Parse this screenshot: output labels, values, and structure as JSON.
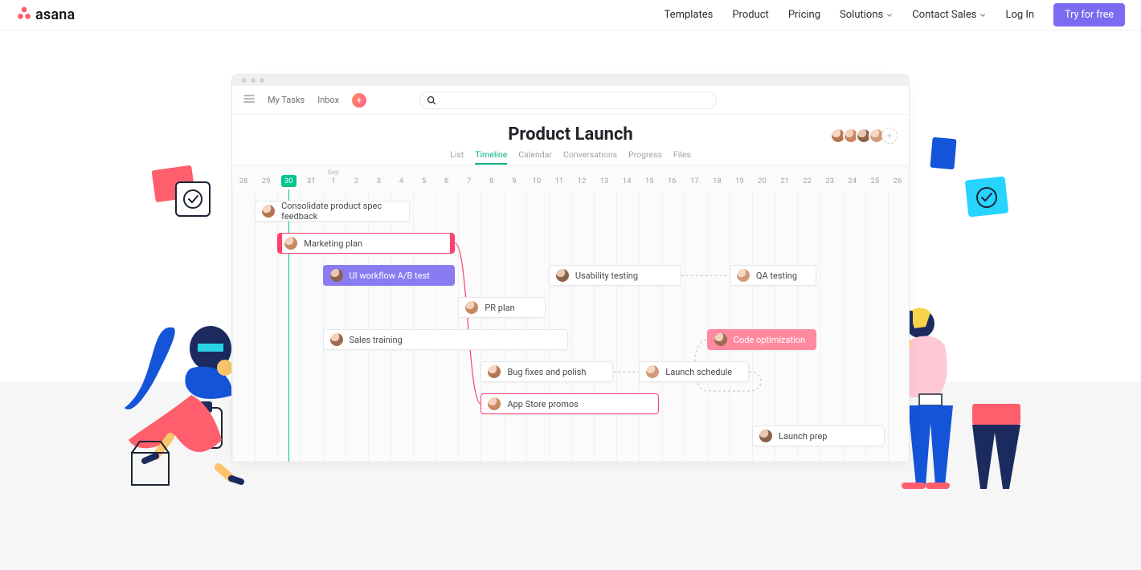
{
  "nav": {
    "brand": "asana",
    "links": [
      "Templates",
      "Product",
      "Pricing",
      "Solutions",
      "Contact Sales",
      "Log In"
    ],
    "cta": "Try for free"
  },
  "app": {
    "toolbar": {
      "my_tasks": "My Tasks",
      "inbox": "Inbox"
    },
    "project": {
      "title": "Product Launch",
      "tabs": [
        "List",
        "Timeline",
        "Calendar",
        "Conversations",
        "Progress",
        "Files"
      ],
      "active_tab": 1
    },
    "timeline": {
      "month_label": "Sep",
      "month_label_day_index": 4,
      "days": [
        "28",
        "29",
        "30",
        "31",
        "1",
        "2",
        "3",
        "4",
        "5",
        "6",
        "7",
        "8",
        "9",
        "10",
        "11",
        "12",
        "13",
        "14",
        "15",
        "16",
        "17",
        "18",
        "19",
        "20",
        "21",
        "22",
        "23",
        "24",
        "25",
        "26"
      ],
      "today_index": 2,
      "today": "30"
    },
    "tasks": [
      {
        "id": "consolidate",
        "label": "Consolidate product spec feedback",
        "start": 1,
        "span": 7,
        "row": 0,
        "style": "plain",
        "avatar": "a1"
      },
      {
        "id": "marketing",
        "label": "Marketing plan",
        "start": 2,
        "span": 8,
        "row": 1,
        "style": "marketing",
        "avatar": "a2"
      },
      {
        "id": "abtest",
        "label": "UI workflow A/B test",
        "start": 4,
        "span": 6,
        "row": 2,
        "style": "ab",
        "avatar": "a3"
      },
      {
        "id": "usability",
        "label": "Usability testing",
        "start": 14,
        "span": 6,
        "row": 2,
        "style": "plain",
        "avatar": "a3"
      },
      {
        "id": "qa",
        "label": "QA testing",
        "start": 22,
        "span": 4,
        "row": 2,
        "style": "plain",
        "avatar": "a4"
      },
      {
        "id": "pr",
        "label": "PR plan",
        "start": 10,
        "span": 4,
        "row": 3,
        "style": "plain",
        "avatar": "a2"
      },
      {
        "id": "sales",
        "label": "Sales training",
        "start": 4,
        "span": 11,
        "row": 4,
        "style": "plain",
        "avatar": "a5"
      },
      {
        "id": "codeopt",
        "label": "Code optimization",
        "start": 21,
        "span": 5,
        "row": 4,
        "style": "code",
        "avatar": "a5"
      },
      {
        "id": "bugs",
        "label": "Bug fixes and polish",
        "start": 11,
        "span": 6,
        "row": 5,
        "style": "plain",
        "avatar": "a1"
      },
      {
        "id": "launch",
        "label": "Launch schedule",
        "start": 18,
        "span": 5,
        "row": 5,
        "style": "plain",
        "avatar": "a4"
      },
      {
        "id": "promos",
        "label": "App Store promos",
        "start": 11,
        "span": 8,
        "row": 6,
        "style": "promos",
        "avatar": "a2"
      },
      {
        "id": "prep",
        "label": "Launch prep",
        "start": 23,
        "span": 6,
        "row": 7,
        "style": "plain",
        "avatar": "a3"
      }
    ]
  },
  "chart_data": {
    "type": "gantt",
    "title": "Product Launch",
    "x_unit": "day",
    "x_range": [
      "Aug 28",
      "Sep 26"
    ],
    "today": "Aug 30",
    "swimlanes": 8,
    "tasks": [
      {
        "name": "Consolidate product spec feedback",
        "start": "Aug 29",
        "end": "Sep 4",
        "row": 0,
        "color": "#FFFFFF"
      },
      {
        "name": "Marketing plan",
        "start": "Aug 30",
        "end": "Sep 6",
        "row": 1,
        "color": "#FF3E6C",
        "highlight": true
      },
      {
        "name": "UI workflow A/B test",
        "start": "Sep 1",
        "end": "Sep 6",
        "row": 2,
        "color": "#8B7BF2"
      },
      {
        "name": "Usability testing",
        "start": "Sep 11",
        "end": "Sep 16",
        "row": 2,
        "color": "#FFFFFF"
      },
      {
        "name": "QA testing",
        "start": "Sep 19",
        "end": "Sep 22",
        "row": 2,
        "color": "#FFFFFF"
      },
      {
        "name": "PR plan",
        "start": "Sep 7",
        "end": "Sep 10",
        "row": 3,
        "color": "#FFFFFF"
      },
      {
        "name": "Sales training",
        "start": "Sep 1",
        "end": "Sep 11",
        "row": 4,
        "color": "#FFFFFF"
      },
      {
        "name": "Code optimization",
        "start": "Sep 18",
        "end": "Sep 22",
        "row": 4,
        "color": "#FF8AA0"
      },
      {
        "name": "Bug fixes and polish",
        "start": "Sep 8",
        "end": "Sep 13",
        "row": 5,
        "color": "#FFFFFF"
      },
      {
        "name": "Launch schedule",
        "start": "Sep 15",
        "end": "Sep 19",
        "row": 5,
        "color": "#FFFFFF"
      },
      {
        "name": "App Store promos",
        "start": "Sep 8",
        "end": "Sep 15",
        "row": 6,
        "color": "#FFFFFF",
        "border": "#FF3E6C"
      },
      {
        "name": "Launch prep",
        "start": "Sep 20",
        "end": "Sep 25",
        "row": 7,
        "color": "#FFFFFF"
      }
    ],
    "dependencies": [
      [
        "Marketing plan",
        "App Store promos"
      ],
      [
        "Bug fixes and polish",
        "Launch schedule"
      ],
      [
        "Usability testing",
        "QA testing"
      ],
      [
        "Launch schedule",
        "Code optimization"
      ]
    ]
  }
}
